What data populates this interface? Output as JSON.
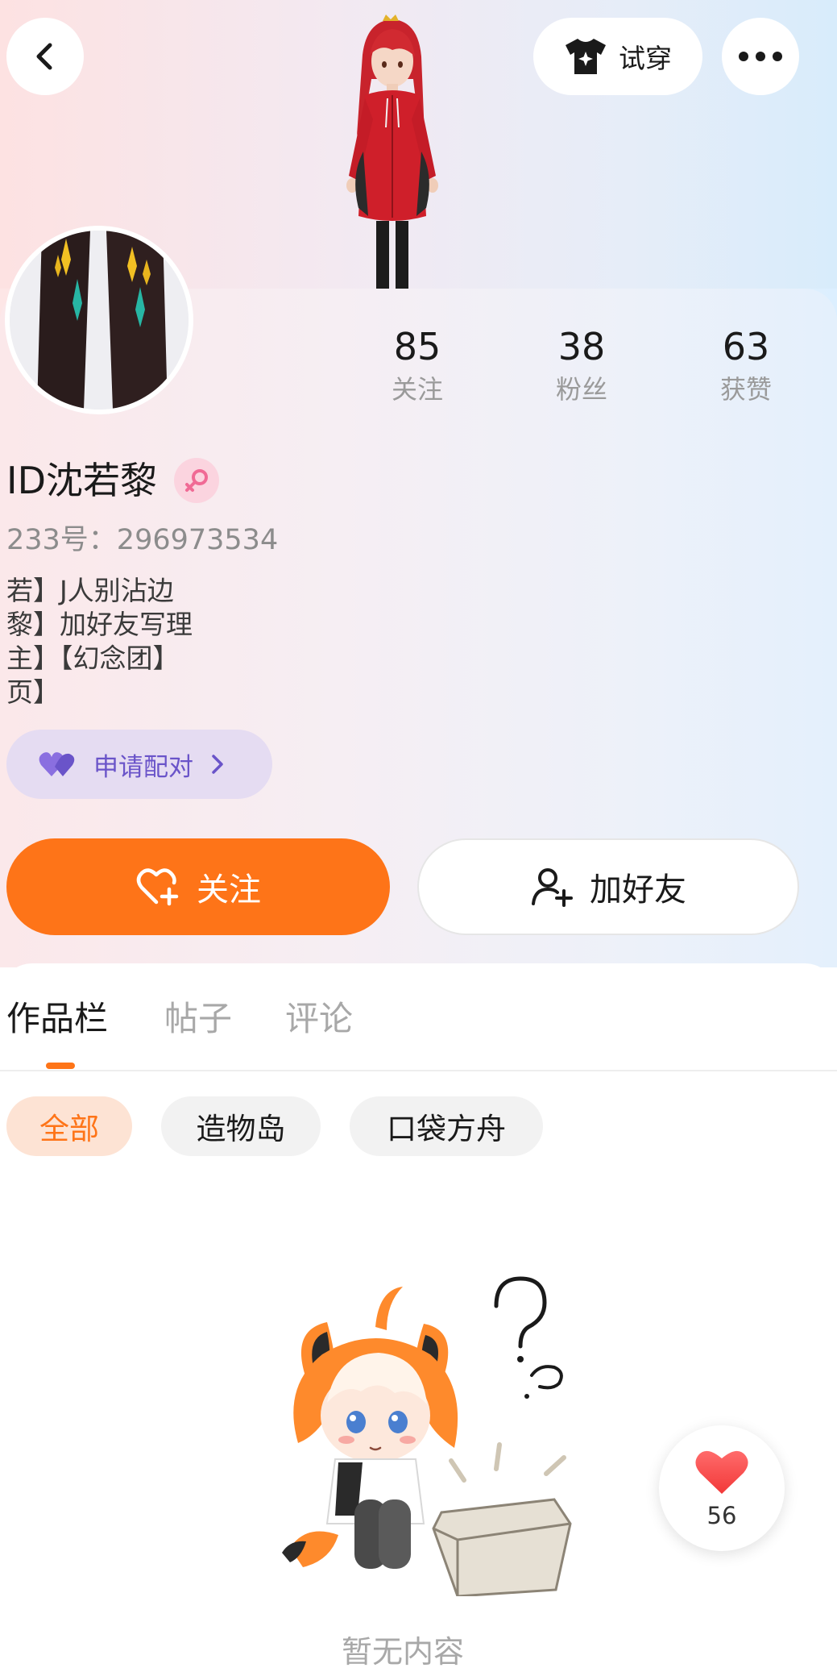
{
  "header": {
    "try_on_label": "试穿",
    "back_icon": "chevron-left-icon",
    "more_icon": "more-dots-icon",
    "try_on_icon": "tshirt-sparkle-icon"
  },
  "profile": {
    "stats": [
      {
        "value": "85",
        "label": "关注"
      },
      {
        "value": "38",
        "label": "粉丝"
      },
      {
        "value": "63",
        "label": "获赞"
      }
    ],
    "username": "ID沈若黎",
    "gender_icon": "female-icon",
    "uid_line": "233号：296973534",
    "bio_lines": [
      "若】J人别沾边",
      "黎】加好友写理",
      "主】【幻念团】",
      "页】"
    ],
    "pair_button": "申请配对",
    "follow_button": "关注",
    "add_friend_button": "加好友"
  },
  "tabs": [
    "作品栏",
    "帖子",
    "评论"
  ],
  "active_tab": "作品栏",
  "filters": [
    "全部",
    "造物岛",
    "口袋方舟"
  ],
  "active_filter": "全部",
  "empty_state": {
    "text": "暂无内容"
  },
  "like_float": {
    "count": "56",
    "icon": "heart-icon"
  },
  "colors": {
    "accent": "#fe7418",
    "pair_purple": "#6a54c9",
    "pair_bg": "#e5dcf2",
    "female_pink": "#f06a95"
  }
}
